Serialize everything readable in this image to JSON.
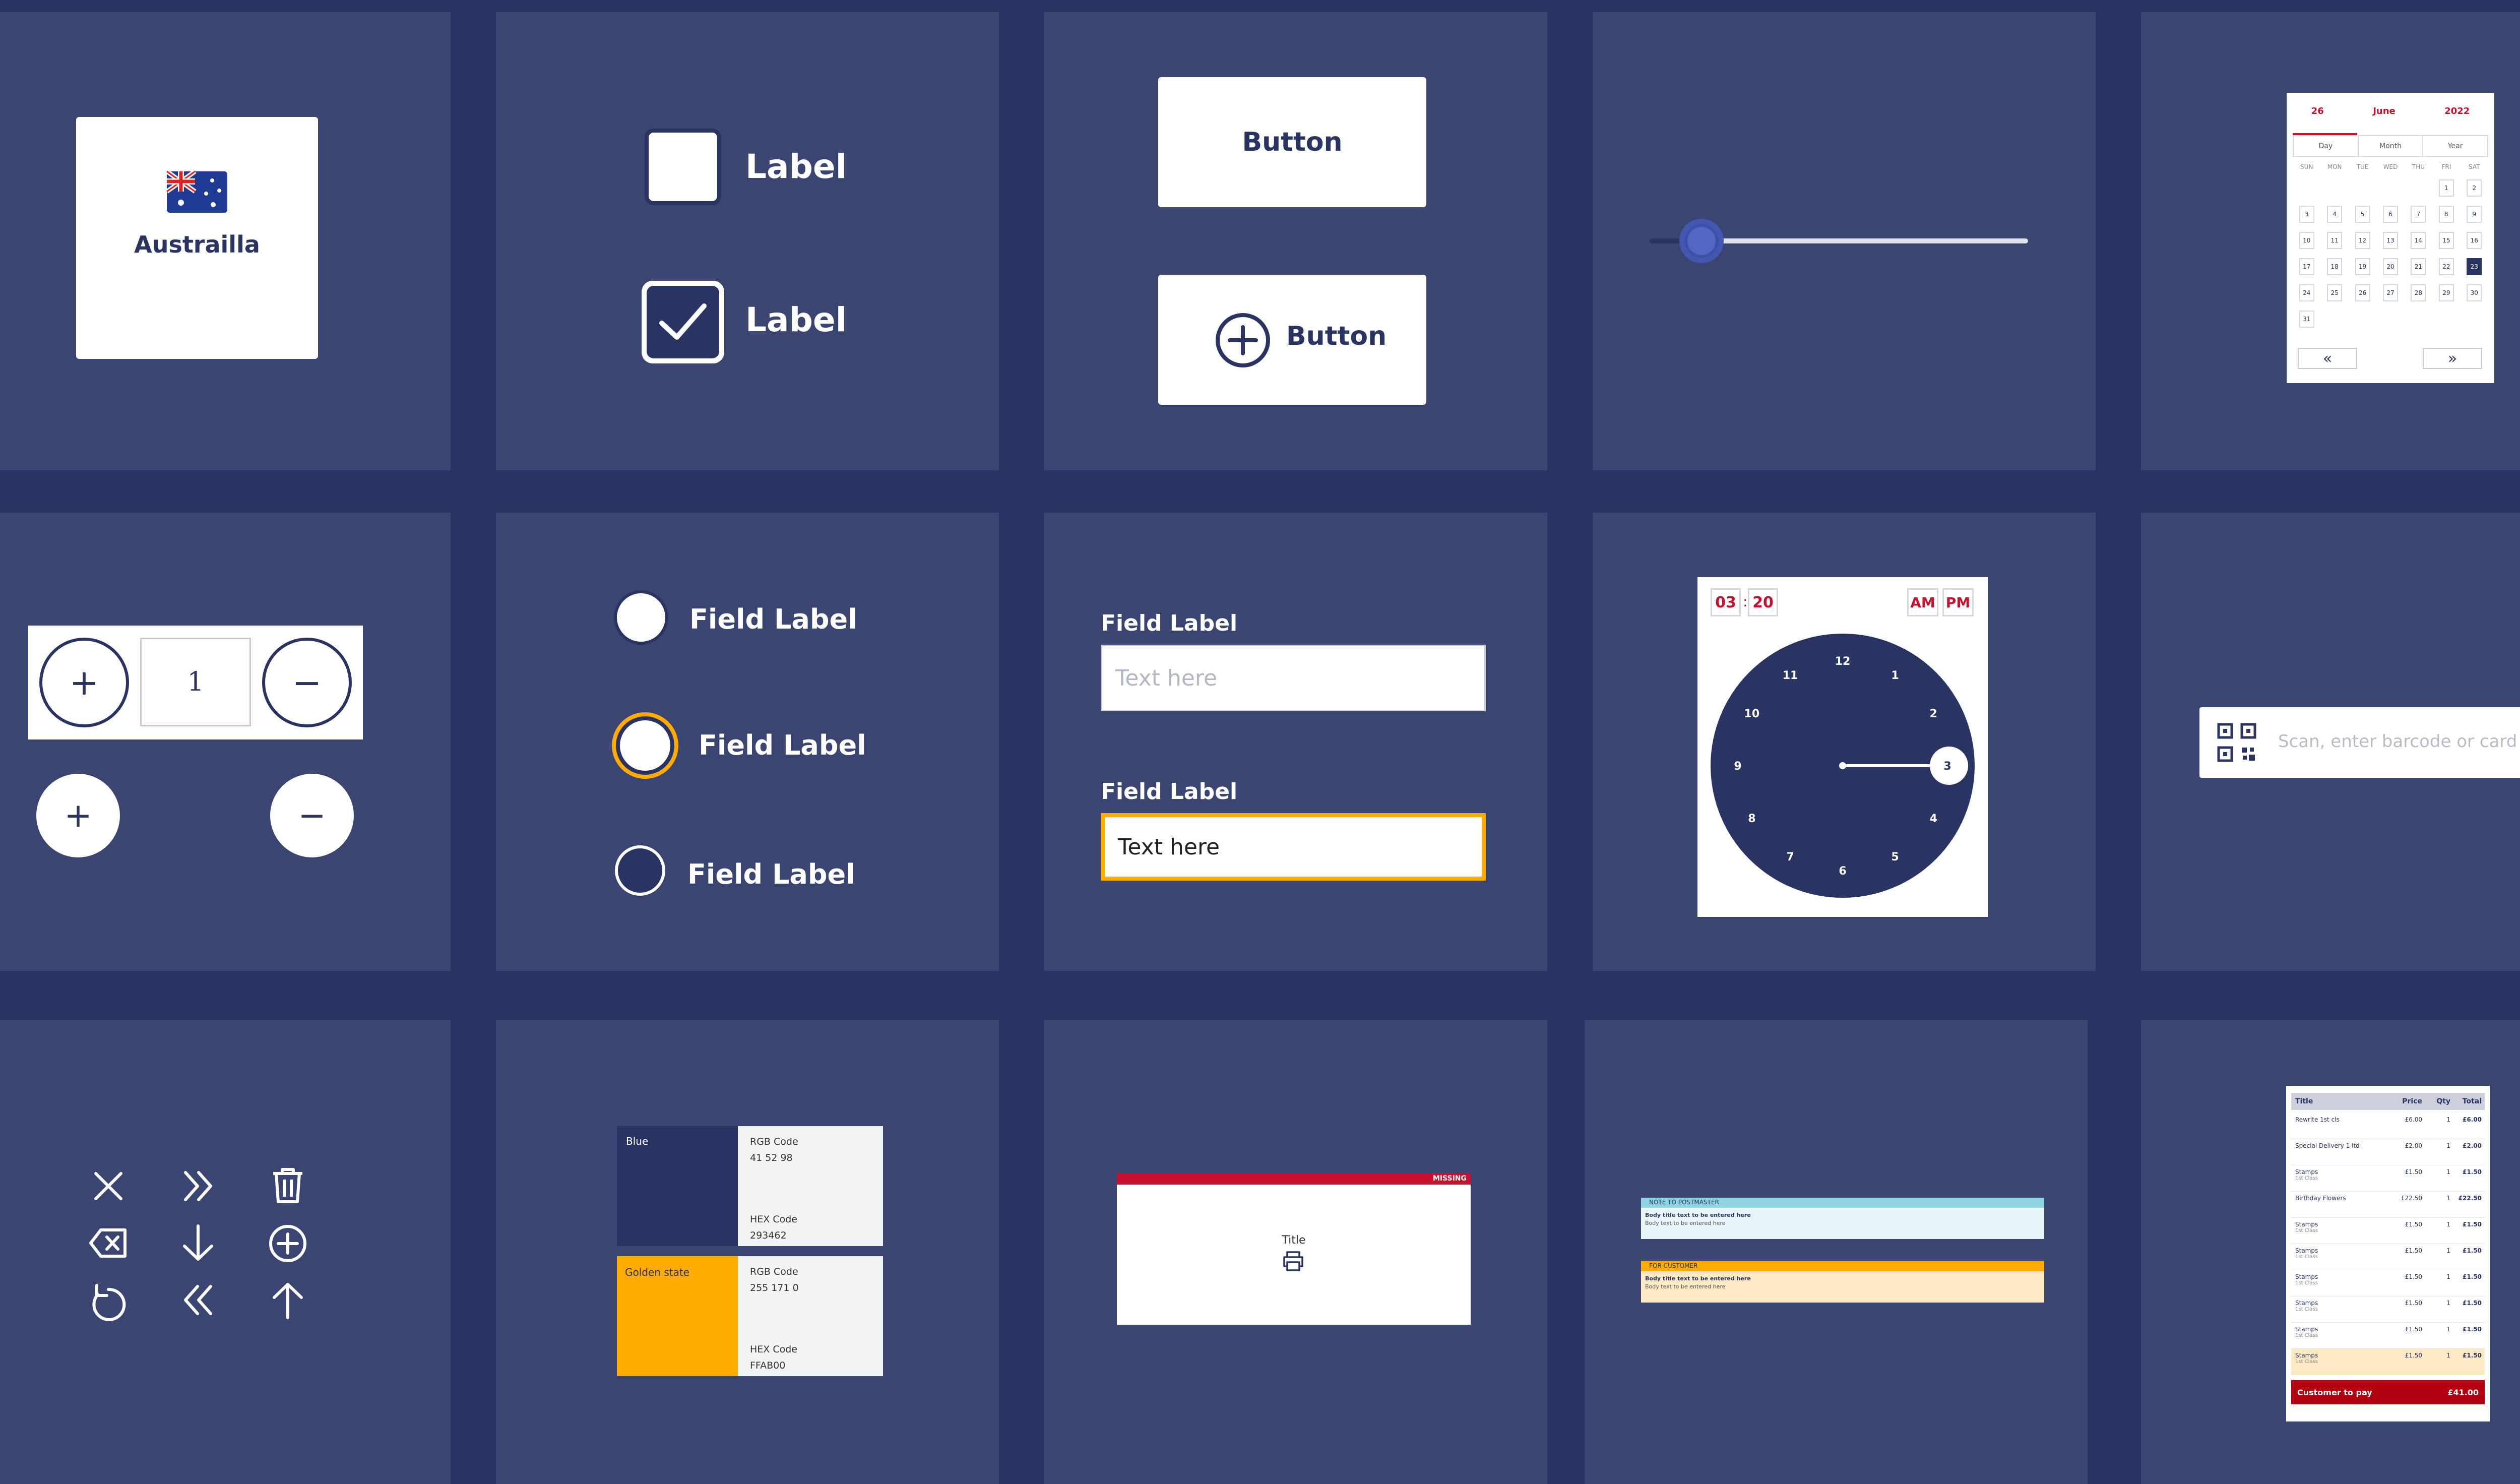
{
  "country_card": {
    "label": "Austrailla"
  },
  "checkboxes": [
    {
      "label": "Label",
      "checked": false
    },
    {
      "label": "Label",
      "checked": true
    }
  ],
  "buttons": {
    "primary": "Button",
    "with_icon": "Button"
  },
  "slider": {
    "value": 0.14
  },
  "calendar": {
    "day": "26",
    "month": "June",
    "year": "2022",
    "views": [
      "Day",
      "Month",
      "Year"
    ],
    "weekdays": [
      "SUN",
      "MON",
      "TUE",
      "WED",
      "THU",
      "FRI",
      "SAT"
    ],
    "weeks": [
      [
        "",
        "",
        "",
        "",
        "",
        "1",
        "2"
      ],
      [
        "3",
        "4",
        "5",
        "6",
        "7",
        "8",
        "9"
      ],
      [
        "10",
        "11",
        "12",
        "13",
        "14",
        "15",
        "16"
      ],
      [
        "17",
        "18",
        "19",
        "20",
        "21",
        "22",
        "23"
      ],
      [
        "24",
        "25",
        "26",
        "27",
        "28",
        "29",
        "30"
      ],
      [
        "31",
        "",
        "",
        "",
        "",
        "",
        ""
      ]
    ],
    "selected": "23",
    "prev": "«",
    "next": "»"
  },
  "stepper": {
    "value": "1",
    "plus": "+",
    "minus": "−"
  },
  "radios": [
    {
      "label": "Field Label",
      "state": "filled"
    },
    {
      "label": "Field Label",
      "state": "focused"
    },
    {
      "label": "Field Label",
      "state": "empty"
    }
  ],
  "text_fields": [
    {
      "label": "Field Label",
      "placeholder": "Text here",
      "value": ""
    },
    {
      "label": "Field Label",
      "placeholder": "",
      "value": "Text here"
    }
  ],
  "time_picker": {
    "hour": "03",
    "minute": "20",
    "am": "AM",
    "pm": "PM",
    "numbers": [
      "12",
      "1",
      "2",
      "3",
      "4",
      "5",
      "6",
      "7",
      "8",
      "9",
      "10",
      "11"
    ]
  },
  "barcode": {
    "placeholder": "Scan, enter barcode or card number"
  },
  "icons": [
    "close-icon",
    "double-chevron-right-icon",
    "trash-icon",
    "backspace-icon",
    "arrow-down-icon",
    "plus-circle-icon",
    "undo-icon",
    "double-chevron-left-icon",
    "arrow-up-icon"
  ],
  "colors": [
    {
      "name": "Blue",
      "rgb_label": "RGB Code",
      "rgb": "41 52 98",
      "hex_label": "HEX Code",
      "hex": "293462",
      "swatch": "#293462"
    },
    {
      "name": "Golden state",
      "rgb_label": "RGB Code",
      "rgb": "255 171 0",
      "hex_label": "HEX Code",
      "hex": "FFAB00",
      "swatch": "#FFAB00"
    }
  ],
  "print_card": {
    "title": "Title",
    "badge": "MISSING"
  },
  "notes": [
    {
      "header": "NOTE TO POSTMASTER",
      "line1": "Body title text to be entered here",
      "line2": "Body text to be entered here",
      "accent": "#8fd3e0",
      "bg": "#e9f4f8"
    },
    {
      "header": "FOR CUSTOMER",
      "line1": "Body title text to be entered here",
      "line2": "Body text to be entered here",
      "accent": "#ffab00",
      "bg": "#fde9c2"
    }
  ],
  "receipt": {
    "headers": [
      "Title",
      "Price",
      "Qty",
      "Total"
    ],
    "rows": [
      {
        "title": "Rewrite 1st cls",
        "sub": "",
        "price": "£6.00",
        "qty": "1",
        "total": "£6.00"
      },
      {
        "title": "Special Delivery 1 ltd",
        "sub": "",
        "price": "£2.00",
        "qty": "1",
        "total": "£2.00"
      },
      {
        "title": "Stamps",
        "sub": "1st Class",
        "price": "£1.50",
        "qty": "1",
        "total": "£1.50"
      },
      {
        "title": "Birthday Flowers",
        "sub": "",
        "price": "£22.50",
        "qty": "1",
        "total": "£22.50"
      },
      {
        "title": "Stamps",
        "sub": "1st Class",
        "price": "£1.50",
        "qty": "1",
        "total": "£1.50"
      },
      {
        "title": "Stamps",
        "sub": "1st Class",
        "price": "£1.50",
        "qty": "1",
        "total": "£1.50"
      },
      {
        "title": "Stamps",
        "sub": "1st Class",
        "price": "£1.50",
        "qty": "1",
        "total": "£1.50"
      },
      {
        "title": "Stamps",
        "sub": "1st Class",
        "price": "£1.50",
        "qty": "1",
        "total": "£1.50"
      },
      {
        "title": "Stamps",
        "sub": "1st Class",
        "price": "£1.50",
        "qty": "1",
        "total": "£1.50"
      },
      {
        "title": "Stamps",
        "sub": "1st Class",
        "price": "£1.50",
        "qty": "1",
        "total": "£1.50"
      }
    ],
    "footer_label": "Customer to pay",
    "footer_total": "£41.00"
  },
  "colors_theme": {
    "navy": "#293462",
    "panel": "#3a4571",
    "gold": "#FFAB00",
    "red": "#c8102e"
  }
}
